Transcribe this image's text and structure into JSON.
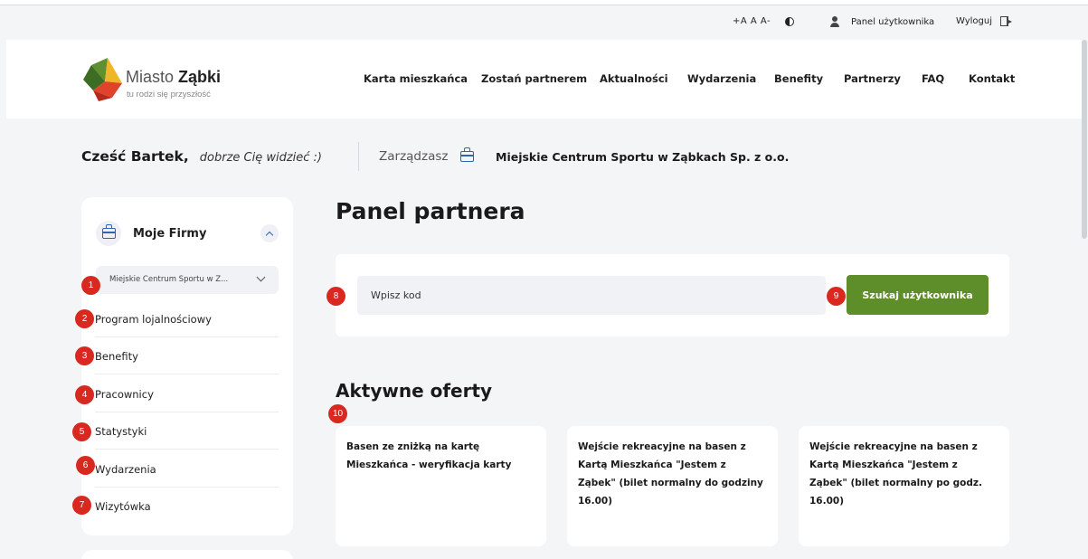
{
  "utility": {
    "font_size": "+A A A-",
    "panel_user": "Panel użytkownika",
    "logout": "Wyloguj"
  },
  "logo": {
    "brand_light": "Miasto ",
    "brand_bold": "Ząbki",
    "tagline": "tu rodzi się przyszłość"
  },
  "nav": [
    {
      "label": "Karta mieszkańca"
    },
    {
      "label": "Zostań partnerem"
    },
    {
      "label": "Aktualności"
    },
    {
      "label": "Wydarzenia"
    },
    {
      "label": "Benefity"
    },
    {
      "label": "Partnerzy"
    },
    {
      "label": "FAQ"
    },
    {
      "label": "Kontakt"
    }
  ],
  "greeting": {
    "hello": "Cześć Bartek,",
    "sub": "dobrze Cię widzieć :)",
    "manage_label": "Zarządzasz",
    "company": "Miejskie Centrum Sportu w Ząbkach Sp. z o.o."
  },
  "sidebar": {
    "title": "Moje Firmy",
    "selected_company": "Miejskie Centrum Sportu w Z...",
    "items": [
      {
        "label": "Program lojalnościowy"
      },
      {
        "label": "Benefity"
      },
      {
        "label": "Pracownicy"
      },
      {
        "label": "Statystyki"
      },
      {
        "label": "Wydarzenia"
      },
      {
        "label": "Wizytówka"
      }
    ]
  },
  "main": {
    "title": "Panel partnera",
    "search_placeholder": "Wpisz kod",
    "search_button": "Szukaj użytkownika",
    "offers_title": "Aktywne oferty",
    "offers": [
      {
        "title": "Basen ze zniżką na kartę Mieszkańca - weryfikacja karty"
      },
      {
        "title": "Wejście rekreacyjne na basen z Kartą Mieszkańca \"Jestem z Ząbek\" (bilet normalny do godziny 16.00)"
      },
      {
        "title": "Wejście rekreacyjne na basen z Kartą Mieszkańca \"Jestem z Ząbek\" (bilet normalny po godz. 16.00)"
      }
    ]
  },
  "markers": [
    "1",
    "2",
    "3",
    "4",
    "5",
    "6",
    "7",
    "8",
    "9",
    "10"
  ],
  "colors": {
    "accent_green": "#5e8e2a",
    "accent_blue": "#2d65b4",
    "marker_red": "#d8281f",
    "background": "#f4f5f7"
  },
  "icons": [
    "contrast-icon",
    "user-icon",
    "logout-icon",
    "briefcase-icon",
    "chevron-up-icon",
    "chevron-down-icon"
  ]
}
